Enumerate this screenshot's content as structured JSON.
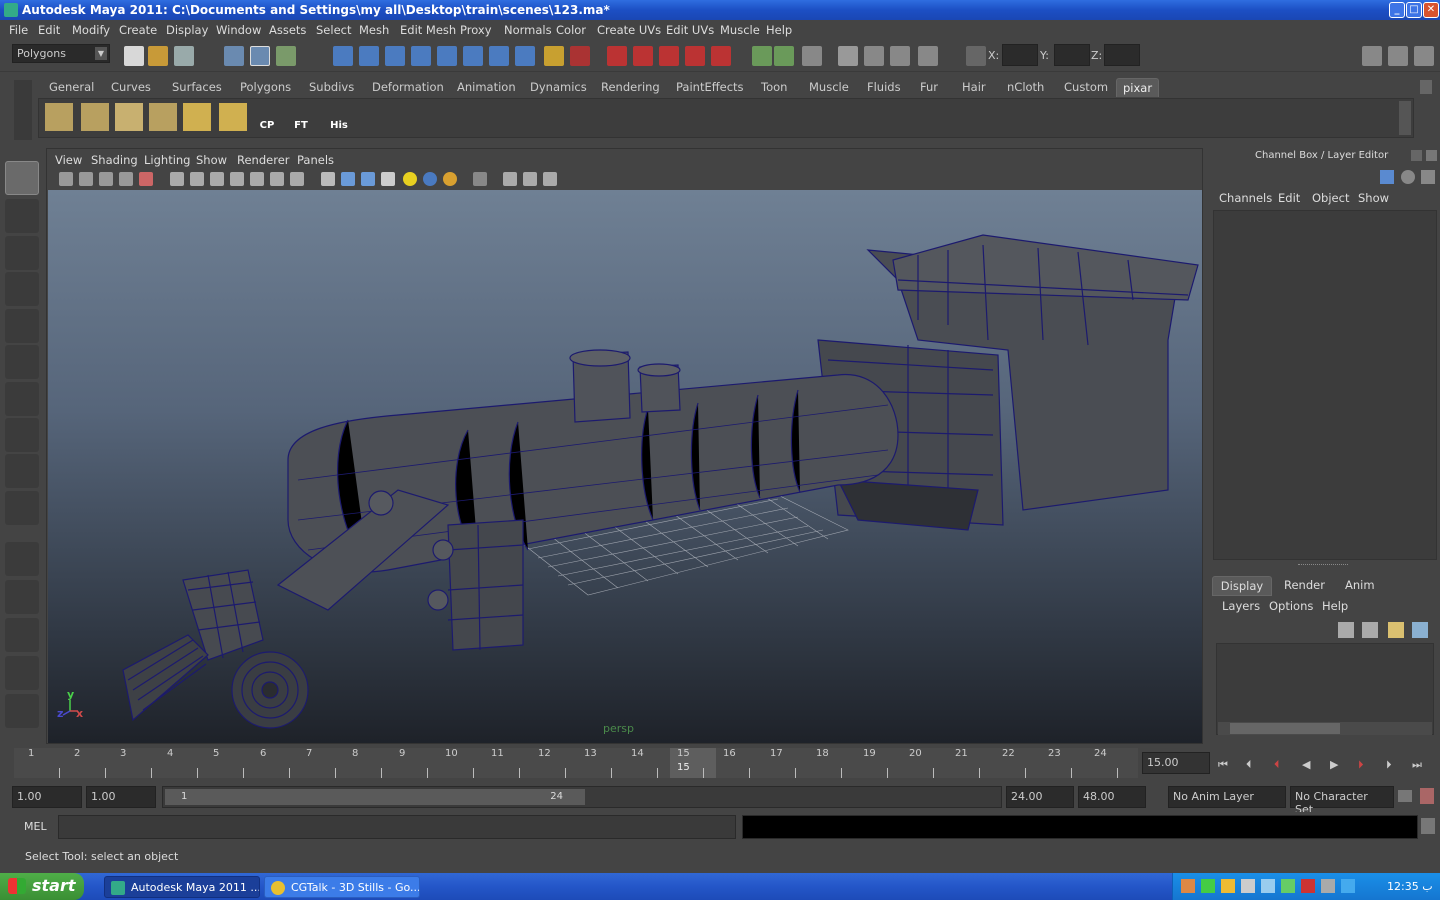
{
  "window": {
    "title": "Autodesk Maya 2011: C:\\Documents and Settings\\my all\\Desktop\\train\\scenes\\123.ma*",
    "min": "_",
    "max": "□",
    "close": "✕"
  },
  "menubar": [
    "File",
    "Edit",
    "Modify",
    "Create",
    "Display",
    "Window",
    "Assets",
    "Select",
    "Mesh",
    "Edit Mesh",
    "Proxy",
    "Normals",
    "Color",
    "Create UVs",
    "Edit UVs",
    "Muscle",
    "Help"
  ],
  "statusline": {
    "menuset": "Polygons",
    "x_label": "X:",
    "y_label": "Y:",
    "z_label": "Z:"
  },
  "shelf": {
    "tabs": [
      "General",
      "Curves",
      "Surfaces",
      "Polygons",
      "Subdivs",
      "Deformation",
      "Animation",
      "Dynamics",
      "Rendering",
      "PaintEffects",
      "Toon",
      "Muscle",
      "Fluids",
      "Fur",
      "Hair",
      "nCloth",
      "Custom",
      "pixar"
    ],
    "active_tab": "pixar",
    "labels": {
      "cp": "CP",
      "ft": "FT",
      "his": "His"
    }
  },
  "panel": {
    "menus": [
      "View",
      "Shading",
      "Lighting",
      "Show",
      "Renderer",
      "Panels"
    ],
    "camera": "persp",
    "axis_y": "y",
    "axis_x": "x",
    "axis_z": "z"
  },
  "channelbox": {
    "title": "Channel Box / Layer Editor",
    "menus": [
      "Channels",
      "Edit",
      "Object",
      "Show"
    ],
    "layer_tabs": [
      "Display",
      "Render",
      "Anim"
    ],
    "layer_menus": [
      "Layers",
      "Options",
      "Help"
    ]
  },
  "timeline": {
    "ticks": [
      "1",
      "2",
      "3",
      "4",
      "5",
      "6",
      "7",
      "8",
      "9",
      "10",
      "11",
      "12",
      "13",
      "14",
      "15",
      "16",
      "17",
      "18",
      "19",
      "20",
      "21",
      "22",
      "23",
      "24"
    ],
    "current_frame": "15",
    "current_field": "15.00"
  },
  "range": {
    "start": "1.00",
    "playback_start": "1.00",
    "slider_start": "1",
    "slider_end": "24",
    "playback_end": "24.00",
    "end": "48.00",
    "anim_layer": "No Anim Layer",
    "character_set": "No Character Set"
  },
  "mel": {
    "label": "MEL"
  },
  "helpline": "Select Tool: select an object",
  "taskbar": {
    "start": "start",
    "tasks": [
      "Autodesk Maya 2011 ...",
      "CGTalk - 3D Stills - Go..."
    ],
    "clock": "12:35 ب"
  }
}
